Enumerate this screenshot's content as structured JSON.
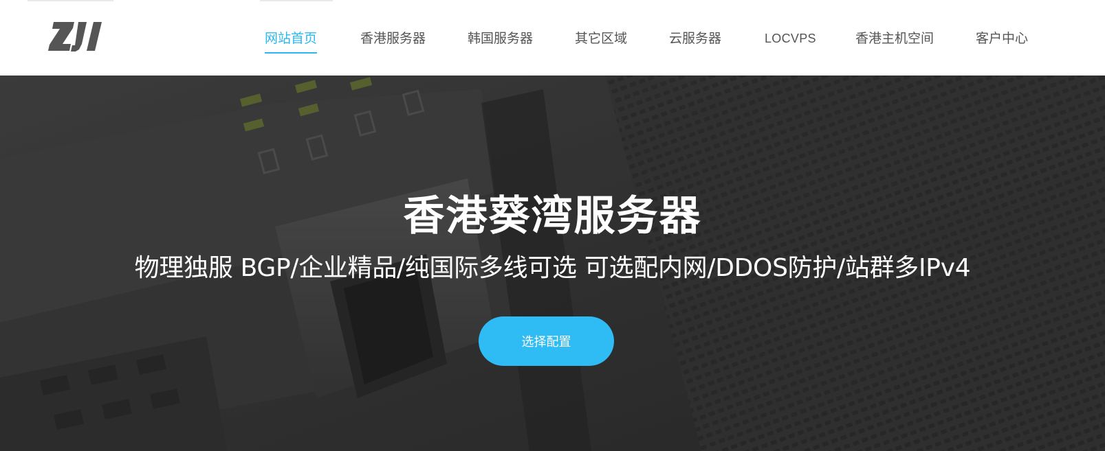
{
  "header": {
    "logo_text": "ZJI",
    "logo_color": "#555555",
    "accent_color": "#2ab8f0"
  },
  "nav": {
    "items": [
      {
        "label": "网站首页",
        "active": true
      },
      {
        "label": "香港服务器",
        "active": false
      },
      {
        "label": "韩国服务器",
        "active": false
      },
      {
        "label": "其它区域",
        "active": false
      },
      {
        "label": "云服务器",
        "active": false
      },
      {
        "label": "LOCVPS",
        "active": false
      },
      {
        "label": "香港主机空间",
        "active": false
      },
      {
        "label": "客户中心",
        "active": false
      }
    ]
  },
  "hero": {
    "title": "香港葵湾服务器",
    "subtitle": "物理独服 BGP/企业精品/纯国际多线可选 可选配内网/DDOS防护/站群多IPv4",
    "cta_label": "选择配置",
    "cta_color": "#2fbcf5",
    "background_image": "server-rack-photo"
  }
}
